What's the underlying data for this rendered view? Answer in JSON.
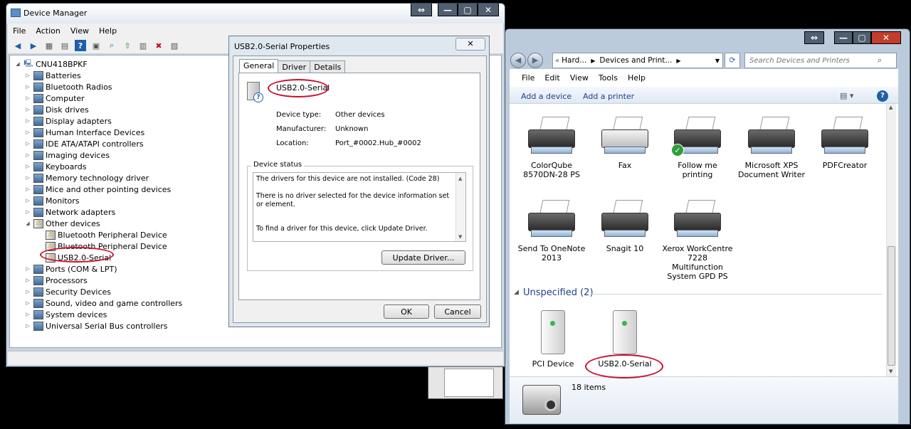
{
  "device_manager": {
    "title": "Device Manager",
    "menu": [
      "File",
      "Action",
      "View",
      "Help"
    ],
    "tree_root": "CNU418BPKF",
    "categories": [
      "Batteries",
      "Bluetooth Radios",
      "Computer",
      "Disk drives",
      "Display adapters",
      "Human Interface Devices",
      "IDE ATA/ATAPI controllers",
      "Imaging devices",
      "Keyboards",
      "Memory technology driver",
      "Mice and other pointing devices",
      "Monitors",
      "Network adapters",
      "Other devices"
    ],
    "other_devices_children": [
      "Bluetooth Peripheral Device",
      "Bluetooth Peripheral Device",
      "USB2.0-Serial"
    ],
    "categories_after": [
      "Ports (COM & LPT)",
      "Processors",
      "Security Devices",
      "Sound, video and game controllers",
      "System devices",
      "Universal Serial Bus controllers"
    ]
  },
  "properties": {
    "title": "USB2.0-Serial Properties",
    "tabs": [
      "General",
      "Driver",
      "Details"
    ],
    "device_name": "USB2.0-Serial",
    "device_type_label": "Device type:",
    "device_type_value": "Other devices",
    "manufacturer_label": "Manufacturer:",
    "manufacturer_value": "Unknown",
    "location_label": "Location:",
    "location_value": "Port_#0002.Hub_#0002",
    "status_group_label": "Device status",
    "status_line1": "The drivers for this device are not installed. (Code 28)",
    "status_line2": "There is no driver selected for the device information set or element.",
    "status_line3": "To find a driver for this device, click Update Driver.",
    "update_driver_button": "Update Driver...",
    "ok_button": "OK",
    "cancel_button": "Cancel"
  },
  "devices_printers": {
    "breadcrumb_part1": "Hard...",
    "breadcrumb_part2": "Devices and Print...",
    "search_placeholder": "Search Devices and Printers",
    "menu": [
      "File",
      "Edit",
      "View",
      "Tools",
      "Help"
    ],
    "add_device": "Add a device",
    "add_printer": "Add a printer",
    "printers_row1": [
      "ColorQube 8570DN-28 PS",
      "Fax",
      "Follow me printing",
      "Microsoft XPS Document Writer",
      "PDFCreator"
    ],
    "printers_row2": [
      "Send To OneNote 2013",
      "Snagit 10",
      "Xerox WorkCentre 7228 Multifunction System GPD PS"
    ],
    "unspecified_header": "Unspecified (2)",
    "unspecified_devices": [
      "PCI Device",
      "USB2.0-Serial"
    ],
    "items_count": "18 items"
  },
  "colors": {
    "highlight_red": "#c8102e",
    "link_blue": "#1e3f8a",
    "group_header_blue": "#1e3f8a"
  }
}
